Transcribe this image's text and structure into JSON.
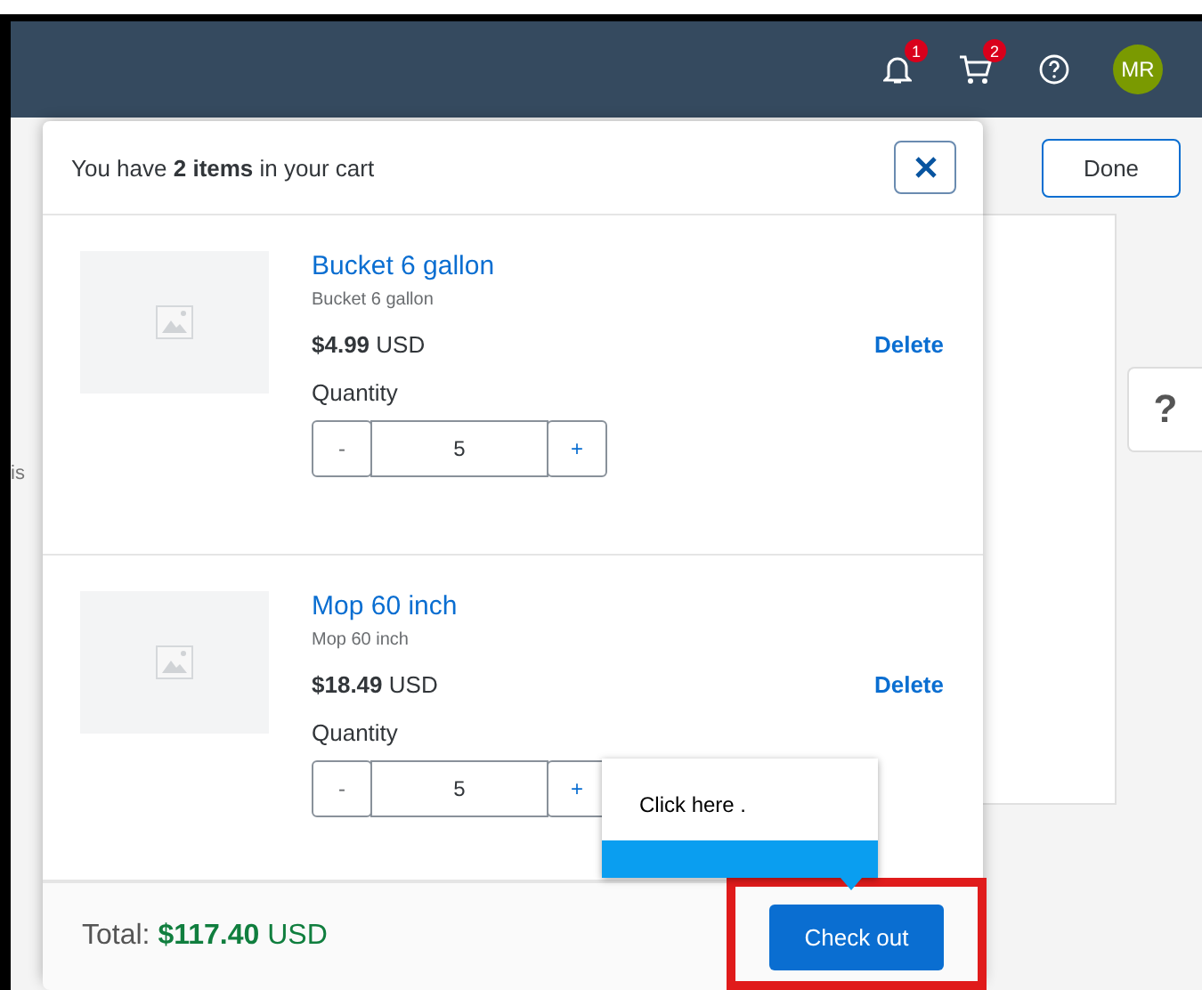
{
  "header": {
    "icons": [
      {
        "kind": "bell",
        "badge": "1"
      },
      {
        "kind": "cart",
        "badge": "2"
      },
      {
        "kind": "help"
      },
      {
        "kind": "avatar",
        "initials": "MR"
      }
    ]
  },
  "page": {
    "done_button": "Done",
    "help_button": "?",
    "cut_text": "is"
  },
  "cart": {
    "summary": "You have **2 items** in your cart",
    "items": [
      {
        "name": "Bucket 6 gallon",
        "description": "Bucket 6 gallon",
        "price": "$4.99",
        "currency": "USD",
        "delete": "Delete",
        "quantity_label": "Quantity",
        "decrement": "-",
        "quantity": "5",
        "increment": "+"
      },
      {
        "name": "Mop 60 inch",
        "description": "Mop 60 inch",
        "price": "$18.49",
        "currency": "USD",
        "delete": "Delete",
        "quantity_label": "Quantity",
        "decrement": "-",
        "quantity": "5",
        "increment": "+"
      }
    ],
    "total_label": "Total:",
    "total": "$117.40",
    "total_currency": "USD",
    "checkout": "Check out"
  },
  "tooltip": {
    "text": "Click here ."
  }
}
